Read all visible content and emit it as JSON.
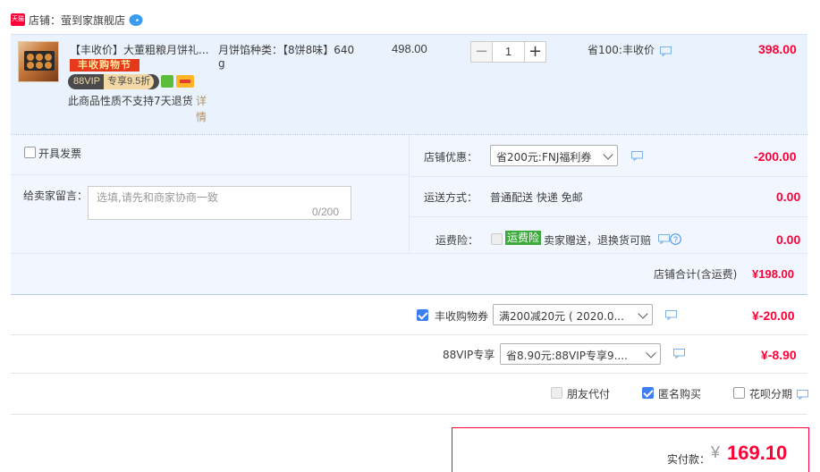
{
  "shop": {
    "badge": "天猫",
    "title": "店铺：萤到家旗舰店"
  },
  "item": {
    "title": "【丰收价】大董粗粮月饼礼...",
    "banner": "丰收购物节",
    "vip_text": "88VIP",
    "vip_discount": "专享9.5折",
    "return_note": "此商品性质不支持7天退货",
    "detail_link": "详情",
    "spec_line1": "月饼馅种类：【8饼8味】640",
    "spec_line2": "g",
    "orig_price": "498.00",
    "qty_minus": "−",
    "qty_value": "1",
    "qty_plus": "+",
    "save_text": "省100:丰收价",
    "total": "398.00"
  },
  "invoice": {
    "label": "开具发票"
  },
  "message": {
    "label": "给卖家留言：",
    "placeholder": "选填,请先和商家协商一致",
    "count": "0/200"
  },
  "shop_discount": {
    "label": "店铺优惠：",
    "selected": "省200元:FNJ福利券",
    "amount": "-200.00"
  },
  "shipping": {
    "label": "运送方式：",
    "value": "普通配送 快递 免邮",
    "amount": "0.00"
  },
  "insurance": {
    "label": "运费险：",
    "badge": "运费险",
    "text": "卖家赠送，退换货可赔",
    "amount": "0.00"
  },
  "shop_total": {
    "label": "店铺合计(含运费)",
    "amount": "¥198.00"
  },
  "coupon": {
    "label": "丰收购物券",
    "selected": "满200减20元 ( 2020.0...",
    "amount": "¥-20.00"
  },
  "vip": {
    "label": "88VIP专享",
    "selected": "省8.90元:88VIP专享9....",
    "amount": "¥-8.90"
  },
  "options": {
    "friend_pay": "朋友代付",
    "anonymous": "匿名购买",
    "huabei": "花呗分期"
  },
  "pay": {
    "label": "实付款：",
    "yen": "¥",
    "amount": "169.10"
  }
}
